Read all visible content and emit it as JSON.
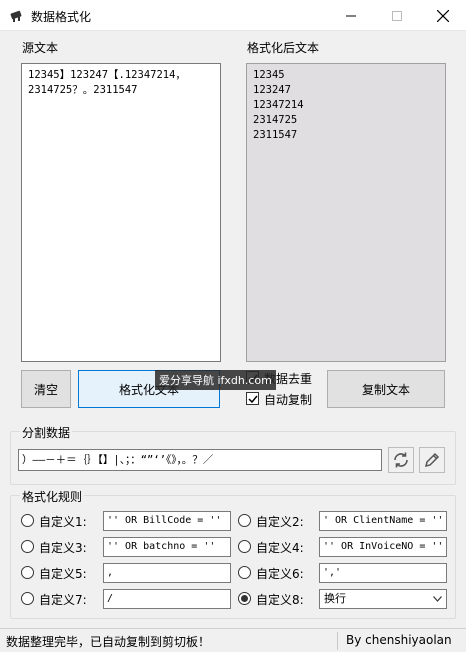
{
  "window": {
    "title": "数据格式化"
  },
  "source": {
    "label": "源文本",
    "text": "12345】123247【.12347214，\n2314725？。2311547"
  },
  "output": {
    "label": "格式化后文本",
    "text": "12345\n123247\n12347214\n2314725\n2311547"
  },
  "buttons": {
    "clear": "清空",
    "format": "格式化文本",
    "copy": "复制文本"
  },
  "options": {
    "dedupe": "数据去重",
    "auto_copy": "自动复制"
  },
  "split": {
    "label": "分割数据",
    "value": "）——－＋＝｛｝【】|、；：“”‘’《》，。？／"
  },
  "watermark": "爱分享导航 ifxdh.com",
  "rules": {
    "label": "格式化规则",
    "items": [
      {
        "label": "自定义1:",
        "value": "'' OR BillCode = ''",
        "selected": false
      },
      {
        "label": "自定义2:",
        "value": "' OR ClientName = ''",
        "selected": false
      },
      {
        "label": "自定义3:",
        "value": "'' OR batchno = ''",
        "selected": false
      },
      {
        "label": "自定义4:",
        "value": "'' OR InVoiceNO = ''",
        "selected": false
      },
      {
        "label": "自定义5:",
        "value": ",",
        "selected": false
      },
      {
        "label": "自定义6:",
        "value": "','",
        "selected": false
      },
      {
        "label": "自定义7:",
        "value": "/",
        "selected": false
      },
      {
        "label": "自定义8:",
        "value": "换行",
        "selected": true
      }
    ]
  },
  "status": {
    "message": "数据整理完毕，已自动复制到剪切板！",
    "author": "By chenshiyaolan"
  }
}
